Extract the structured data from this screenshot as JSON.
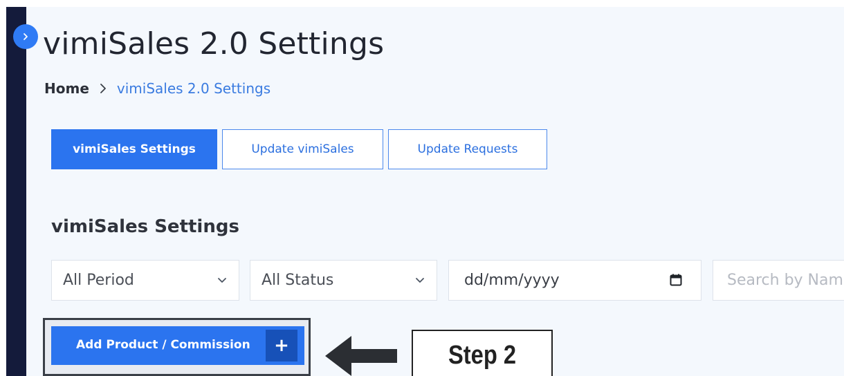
{
  "page": {
    "title": "vimiSales 2.0 Settings"
  },
  "breadcrumb": {
    "home": "Home",
    "current": "vimiSales 2.0 Settings"
  },
  "tabs": [
    {
      "label": "vimiSales Settings",
      "active": true
    },
    {
      "label": "Update vimiSales",
      "active": false
    },
    {
      "label": "Update Requests",
      "active": false
    }
  ],
  "section": {
    "title": "vimiSales Settings"
  },
  "filters": {
    "period": "All Period",
    "status": "All Status",
    "date_placeholder": "dd/mm/yyyy",
    "search_placeholder": "Search by Name"
  },
  "actions": {
    "add_label": "Add Product / Commission",
    "add_icon": "+"
  },
  "annotation": {
    "step_label": "Step 2"
  },
  "colors": {
    "accent": "#2b74ef",
    "sidebar": "#141b3b",
    "background": "#f4f8fd"
  },
  "icons": {
    "expand": "chevron-right-icon",
    "dropdown": "chevron-down-icon",
    "date": "calendar-icon",
    "pointer": "arrow-left-icon"
  }
}
